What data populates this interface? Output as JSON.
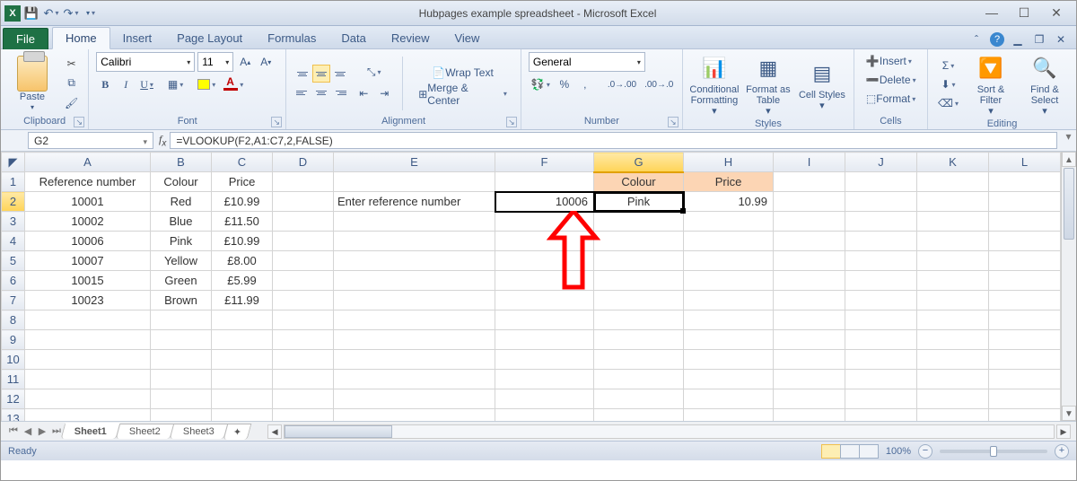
{
  "window": {
    "title": "Hubpages example spreadsheet  -  Microsoft Excel"
  },
  "qat": {
    "save": "💾",
    "undo": "↶",
    "redo": "↷"
  },
  "tabs": {
    "file": "File",
    "items": [
      "Home",
      "Insert",
      "Page Layout",
      "Formulas",
      "Data",
      "Review",
      "View"
    ],
    "active": "Home"
  },
  "ribbon": {
    "clipboard": {
      "label": "Clipboard",
      "paste": "Paste"
    },
    "font": {
      "label": "Font",
      "family": "Calibri",
      "size": "11"
    },
    "alignment": {
      "label": "Alignment",
      "wrap": "Wrap Text",
      "merge": "Merge & Center"
    },
    "number": {
      "label": "Number",
      "format": "General"
    },
    "styles": {
      "label": "Styles",
      "conditional": "Conditional Formatting",
      "formatas": "Format as Table",
      "cell": "Cell Styles"
    },
    "cells": {
      "label": "Cells",
      "insert": "Insert",
      "delete": "Delete",
      "format": "Format"
    },
    "editing": {
      "label": "Editing",
      "sort": "Sort & Filter",
      "find": "Find & Select"
    }
  },
  "namebox": "G2",
  "formula": "=VLOOKUP(F2,A1:C7,2,FALSE)",
  "columns": [
    "A",
    "B",
    "C",
    "D",
    "E",
    "F",
    "G",
    "H",
    "I",
    "J",
    "K",
    "L"
  ],
  "rows": [
    "1",
    "2",
    "3",
    "4",
    "5",
    "6",
    "7",
    "8",
    "9",
    "10",
    "11",
    "12",
    "13"
  ],
  "headers": {
    "a": "Reference number",
    "b": "Colour",
    "c": "Price",
    "g": "Colour",
    "h": "Price"
  },
  "data": [
    {
      "ref": "10001",
      "colour": "Red",
      "price": "£10.99"
    },
    {
      "ref": "10002",
      "colour": "Blue",
      "price": "£11.50"
    },
    {
      "ref": "10006",
      "colour": "Pink",
      "price": "£10.99"
    },
    {
      "ref": "10007",
      "colour": "Yellow",
      "price": "£8.00"
    },
    {
      "ref": "10015",
      "colour": "Green",
      "price": "£5.99"
    },
    {
      "ref": "10023",
      "colour": "Brown",
      "price": "£11.99"
    }
  ],
  "lookup": {
    "prompt": "Enter reference number",
    "input": "10006",
    "colour": "Pink",
    "price": "10.99"
  },
  "sheets": [
    "Sheet1",
    "Sheet2",
    "Sheet3"
  ],
  "activeSheet": "Sheet1",
  "status": {
    "ready": "Ready",
    "zoom": "100%"
  },
  "chart_data": {
    "type": "table",
    "columns": [
      "Reference number",
      "Colour",
      "Price"
    ],
    "rows": [
      [
        10001,
        "Red",
        10.99
      ],
      [
        10002,
        "Blue",
        11.5
      ],
      [
        10006,
        "Pink",
        10.99
      ],
      [
        10007,
        "Yellow",
        8.0
      ],
      [
        10015,
        "Green",
        5.99
      ],
      [
        10023,
        "Brown",
        11.99
      ]
    ],
    "lookup": {
      "input": 10006,
      "result_colour": "Pink",
      "result_price": 10.99,
      "formula_cell": "G2"
    }
  }
}
